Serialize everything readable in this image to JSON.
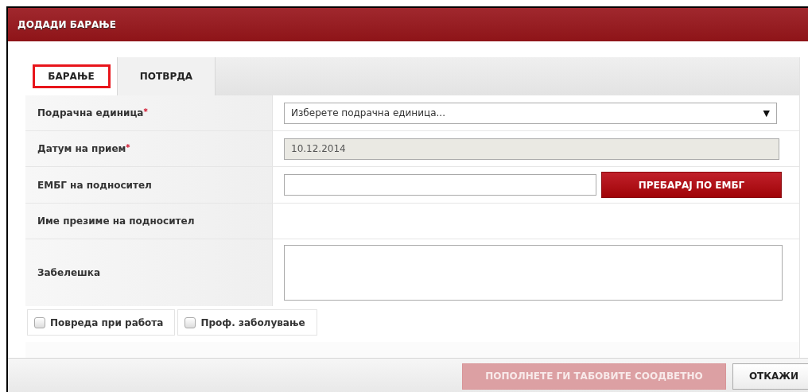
{
  "window": {
    "title": "ДОДАДИ БАРАЊЕ"
  },
  "tabs": [
    {
      "label": "БАРАЊЕ",
      "selected": true,
      "highlighted": true
    },
    {
      "label": "ПОТВРДА",
      "selected": false,
      "highlighted": false
    }
  ],
  "form": {
    "rows": [
      {
        "kind": "select",
        "label": "Подрачна единица",
        "required_mark": "*",
        "placeholder": "Изберете подрачна единица...",
        "caret": "▼"
      },
      {
        "kind": "input",
        "label": "Датум на прием",
        "required_mark": "*",
        "value": "10.12.2014",
        "disabled": true
      },
      {
        "kind": "search",
        "label": "ЕМБГ на подносител",
        "button": "ПРЕБАРАЈ ПО ЕМБГ"
      },
      {
        "kind": "text",
        "label": "Име презиме на подносител"
      },
      {
        "kind": "textarea",
        "label": "Забелешка"
      }
    ],
    "checkboxes": [
      {
        "label": "Повреда при работа",
        "checked": false
      },
      {
        "label": "Проф. заболување",
        "checked": false
      }
    ]
  },
  "footer": {
    "buttons": [
      {
        "label": "ПОПОЛНЕТЕ ГИ ТАБОВИТЕ СООДВЕТНО",
        "kind": "primary",
        "disabled": true
      },
      {
        "label": "ОТКАЖИ",
        "kind": "secondary",
        "disabled": false
      }
    ]
  }
}
